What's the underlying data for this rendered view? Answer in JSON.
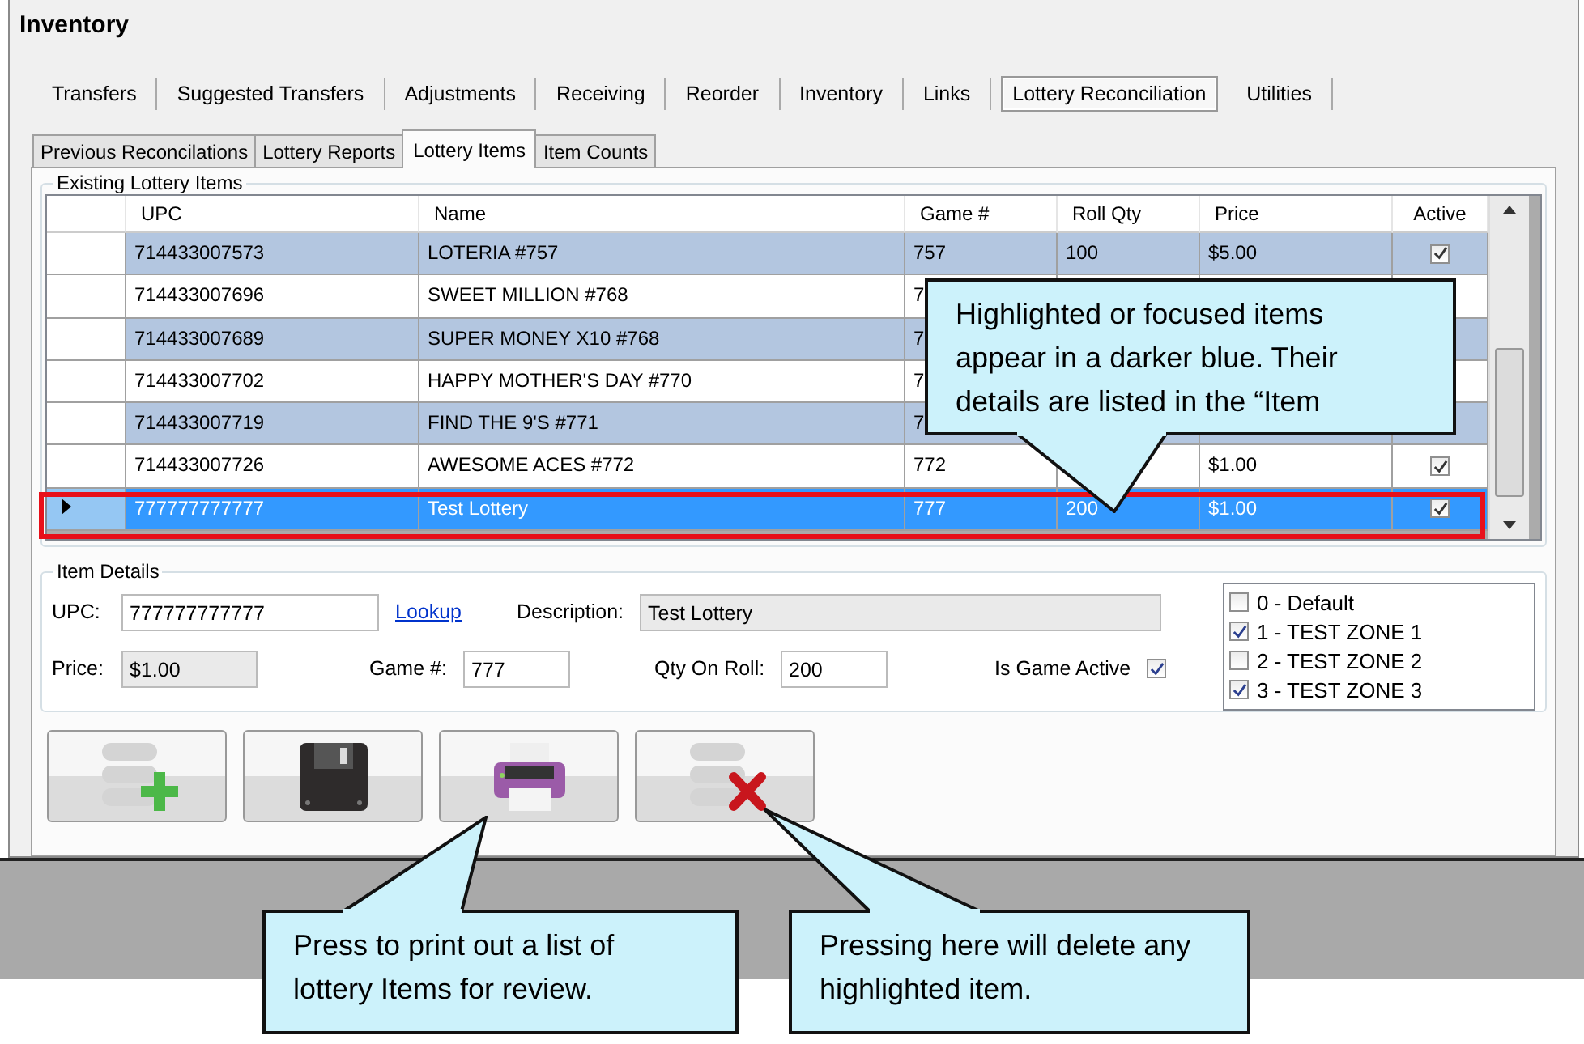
{
  "window": {
    "title": "Inventory"
  },
  "tabs": [
    {
      "label": "Transfers",
      "selected": false
    },
    {
      "label": "Suggested Transfers",
      "selected": false
    },
    {
      "label": "Adjustments",
      "selected": false
    },
    {
      "label": "Receiving",
      "selected": false
    },
    {
      "label": "Reorder",
      "selected": false
    },
    {
      "label": "Inventory",
      "selected": false
    },
    {
      "label": "Links",
      "selected": false
    },
    {
      "label": "Lottery Reconciliation",
      "selected": true
    },
    {
      "label": "Utilities",
      "selected": false
    }
  ],
  "subtabs": [
    {
      "label": "Previous Reconcilations",
      "selected": false
    },
    {
      "label": "Lottery Reports",
      "selected": false
    },
    {
      "label": "Lottery Items",
      "selected": true
    },
    {
      "label": "Item Counts",
      "selected": false
    }
  ],
  "existing_items": {
    "title": "Existing Lottery Items",
    "columns": [
      "UPC",
      "Name",
      "Game #",
      "Roll Qty",
      "Price",
      "Active"
    ],
    "rows": [
      {
        "upc": "714433007573",
        "name": "LOTERIA #757",
        "game": "757",
        "roll_qty": "100",
        "price": "$5.00",
        "active": true,
        "selected": false
      },
      {
        "upc": "714433007696",
        "name": "SWEET MILLION #768",
        "game": "7",
        "selected": false
      },
      {
        "upc": "714433007689",
        "name": "SUPER MONEY X10 #768",
        "game": "7",
        "selected": false
      },
      {
        "upc": "714433007702",
        "name": "HAPPY MOTHER'S DAY #770",
        "game": "7",
        "selected": false
      },
      {
        "upc": "714433007719",
        "name": "FIND THE 9'S #771",
        "game": "7",
        "selected": false
      },
      {
        "upc": "714433007726",
        "name": "AWESOME ACES #772",
        "game": "772",
        "price": "$1.00",
        "active": true,
        "selected": false
      },
      {
        "upc": "777777777777",
        "name": "Test Lottery",
        "game": "777",
        "roll_qty": "200",
        "price": "$1.00",
        "active": true,
        "selected": true
      }
    ]
  },
  "item_details": {
    "title": "Item Details",
    "upc_label": "UPC:",
    "upc": "777777777777",
    "lookup": "Lookup",
    "description_label": "Description:",
    "description": "Test Lottery",
    "price_label": "Price:",
    "price": "$1.00",
    "game_label": "Game #:",
    "game": "777",
    "qty_label": "Qty On Roll:",
    "qty": "200",
    "active_label": "Is Game Active",
    "active": true,
    "zones": [
      {
        "label": "0 - Default",
        "checked": false
      },
      {
        "label": "1 - TEST ZONE 1",
        "checked": true
      },
      {
        "label": "2 - TEST ZONE 2",
        "checked": false
      },
      {
        "label": "3 - TEST ZONE 3",
        "checked": true
      }
    ]
  },
  "buttons": [
    {
      "kind": "add"
    },
    {
      "kind": "save"
    },
    {
      "kind": "print"
    },
    {
      "kind": "delete"
    }
  ],
  "callouts": [
    {
      "kind": "top",
      "text": "Highlighted or focused items appear in a darker blue. Their details are listed in the “Item"
    },
    {
      "kind": "print",
      "text": "Press to print out a list of lottery Items for review."
    },
    {
      "kind": "delete",
      "text": "Pressing here will delete any highlighted item."
    }
  ]
}
